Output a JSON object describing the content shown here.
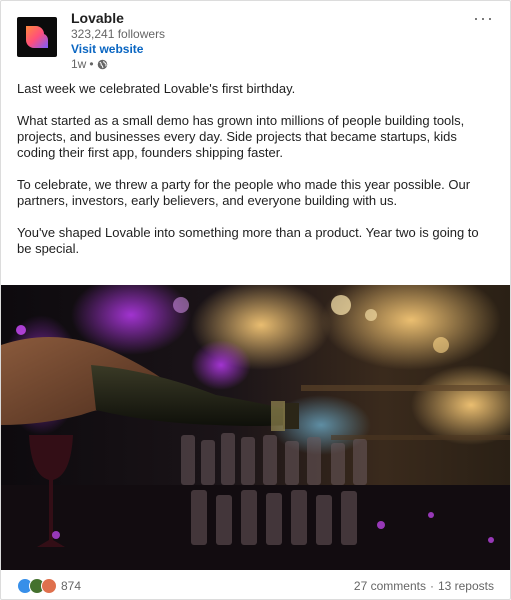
{
  "post": {
    "company": "Lovable",
    "followers": "323,241 followers",
    "visit_label": "Visit website",
    "time": "1w",
    "dot": "•",
    "more_label": "···",
    "paragraphs": [
      "Last week we celebrated Lovable's first birthday.",
      "What started as a small demo has grown into millions of people building tools, projects, and businesses every day. Side projects that became startups, kids coding their first app, founders shipping faster.",
      "To celebrate, we threw a party for the people who made this year possible. Our partners, investors, early believers, and everyone building with us.",
      "You've shaped Lovable into something more than a product. Year two is going to be special."
    ]
  },
  "social": {
    "reaction_count": "874",
    "comments": "27 comments",
    "separator": "·",
    "reposts": "13 reposts",
    "reaction_icons": [
      "like-icon",
      "celebrate-icon",
      "love-icon"
    ],
    "reaction_colors": [
      "#378fe9",
      "#44712e",
      "#df704d"
    ]
  },
  "colors": {
    "link": "#0a66c2",
    "muted": "#666666",
    "logo_gradient": [
      "#ff4f7b",
      "#ff8a3d",
      "#7b5cff"
    ]
  },
  "media": {
    "icon": "party-photo"
  }
}
